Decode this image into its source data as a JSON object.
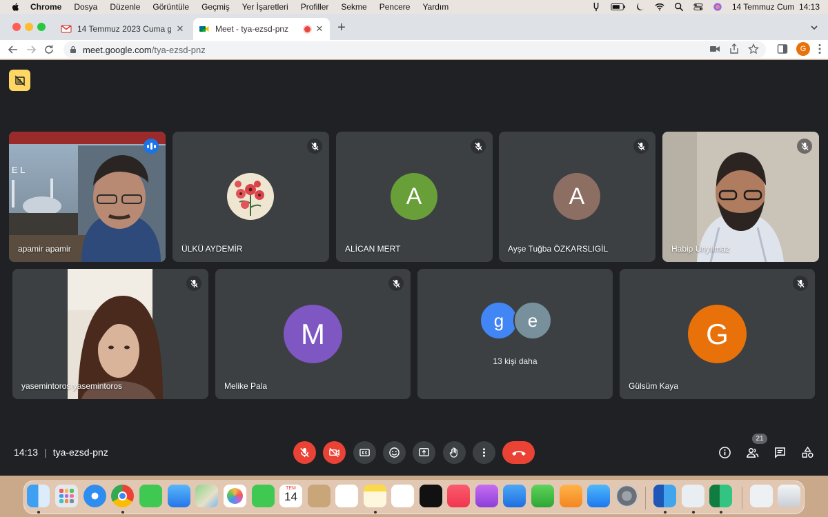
{
  "menubar": {
    "app": "Chrome",
    "items": [
      "Dosya",
      "Düzenle",
      "Görüntüle",
      "Geçmiş",
      "Yer İşaretleri",
      "Profiller",
      "Sekme",
      "Pencere",
      "Yardım"
    ],
    "datetime": "14 Temmuz Cum  14:13"
  },
  "tabs": [
    {
      "title": "14 Temmuz 2023 Cuma günü saat",
      "favicon": "gmail-icon",
      "active": false
    },
    {
      "title": "Meet - tya-ezsd-pnz",
      "favicon": "meet-icon",
      "active": true
    }
  ],
  "address": {
    "host": "meet.google.com",
    "path": "/tya-ezsd-pnz"
  },
  "profile_initial": "G",
  "participants": [
    {
      "name": "apamir apamir",
      "type": "video",
      "speaking": true
    },
    {
      "name": "ÜLKÜ AYDEMİR",
      "type": "image-avatar",
      "muted": true
    },
    {
      "name": "ALİCAN MERT",
      "type": "letter",
      "letter": "A",
      "color": "#689f38",
      "muted": true
    },
    {
      "name": "Ayşe Tuğba ÖZKARSLIGİL",
      "type": "letter",
      "letter": "A",
      "color": "#8d6e63",
      "muted": true
    },
    {
      "name": "Habip Ünyılmaz",
      "type": "video",
      "muted": true
    },
    {
      "name": "yasemintoros yasemintoros",
      "type": "video",
      "muted": true
    },
    {
      "name": "Melike Pala",
      "type": "letter",
      "letter": "M",
      "color": "#7e57c2",
      "muted": true
    },
    {
      "name": "Gülsüm Kaya",
      "type": "letter",
      "letter": "G",
      "color": "#e8710a",
      "muted": true
    }
  ],
  "others": {
    "label": "13 kişi daha",
    "avatars": [
      {
        "letter": "g",
        "color": "#4285f4"
      },
      {
        "letter": "e",
        "color": "#78909c"
      }
    ]
  },
  "meeting": {
    "time": "14:13",
    "separator": "|",
    "code": "tya-ezsd-pnz"
  },
  "people_count": "21",
  "calendar": {
    "month": "TEM",
    "day": "14"
  },
  "colors": {
    "stage": "#202124",
    "tile": "#3c4043",
    "danger": "#ea4335",
    "speaking": "#8ab4f8"
  }
}
